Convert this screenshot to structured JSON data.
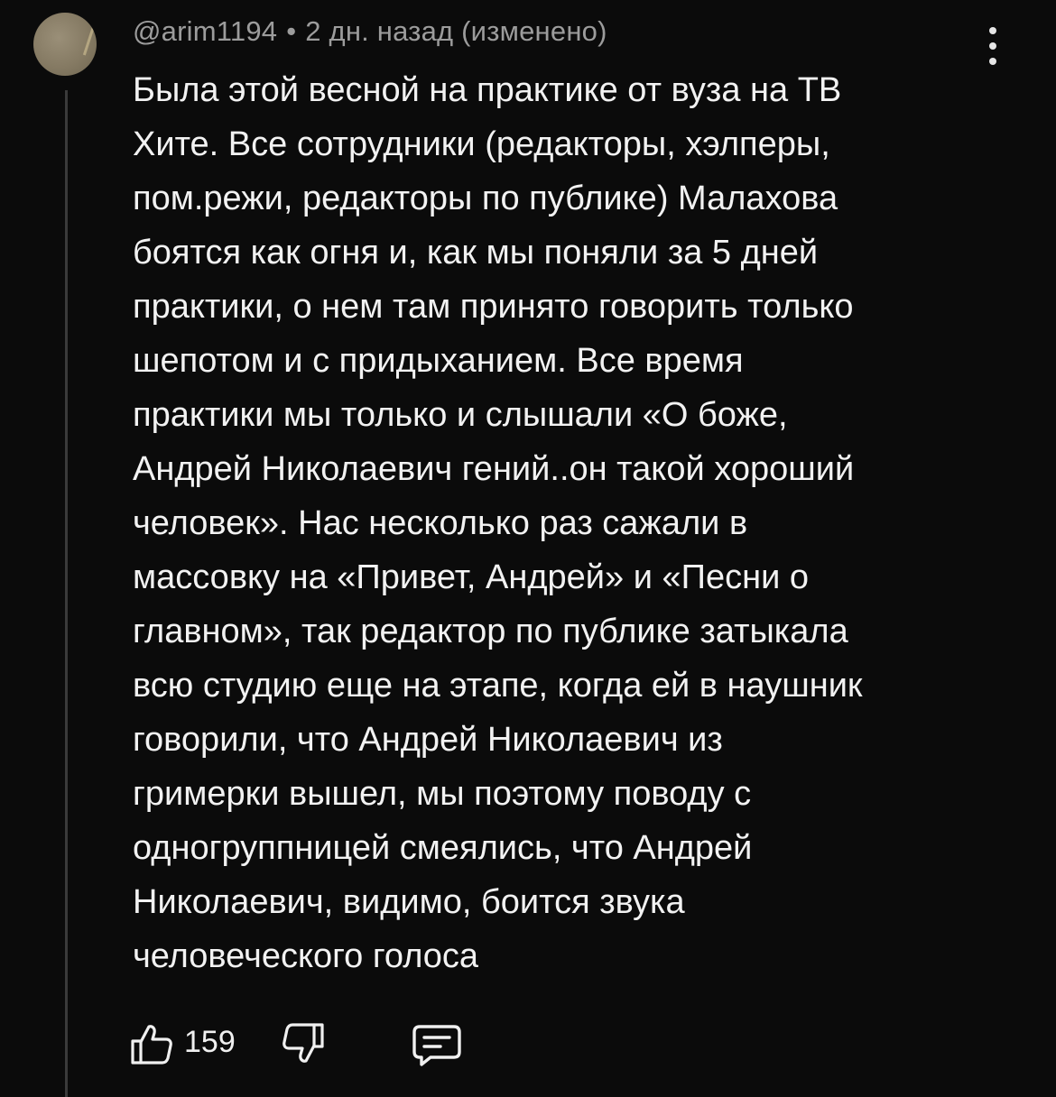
{
  "author": {
    "username": "@arim1194",
    "separator": "•",
    "time": "2 дн. назад",
    "edited": "(изменено)"
  },
  "comment": {
    "lines": [
      "Была этой весной на практике от вуза на ТВ",
      "Хите. Все сотрудники (редакторы, хэлперы,",
      "пом.режи, редакторы по публике) Малахова",
      "боятся как огня и, как мы поняли за 5 дней",
      "практики, о нем там принято говорить только",
      "шепотом и с придыханием. Все время",
      "практики мы только и слышали «О боже,",
      "Андрей Николаевич гений..он такой хороший",
      "человек». Нас несколько раз сажали в",
      "массовку на «Привет, Андрей» и «Песни о",
      "главном», так редактор по публике затыкала",
      "всю студию еще на этапе, когда ей в наушник",
      "говорили, что Андрей Николаевич из",
      "гримерки вышел, мы поэтому поводу с",
      "одногруппницей смеялись, что Андрей",
      "Николаевич, видимо, боится звука",
      "человеческого голоса"
    ]
  },
  "actions": {
    "like_count": "159",
    "like_icon": "thumbs-up-icon",
    "dislike_icon": "thumbs-down-icon",
    "reply_icon": "reply-comment-icon",
    "menu_icon": "more-vertical-icon"
  },
  "colors": {
    "background": "#0b0b0b",
    "text": "#f2f2f2",
    "meta": "#9c9c9c",
    "thread_line": "#3a3a3a"
  }
}
